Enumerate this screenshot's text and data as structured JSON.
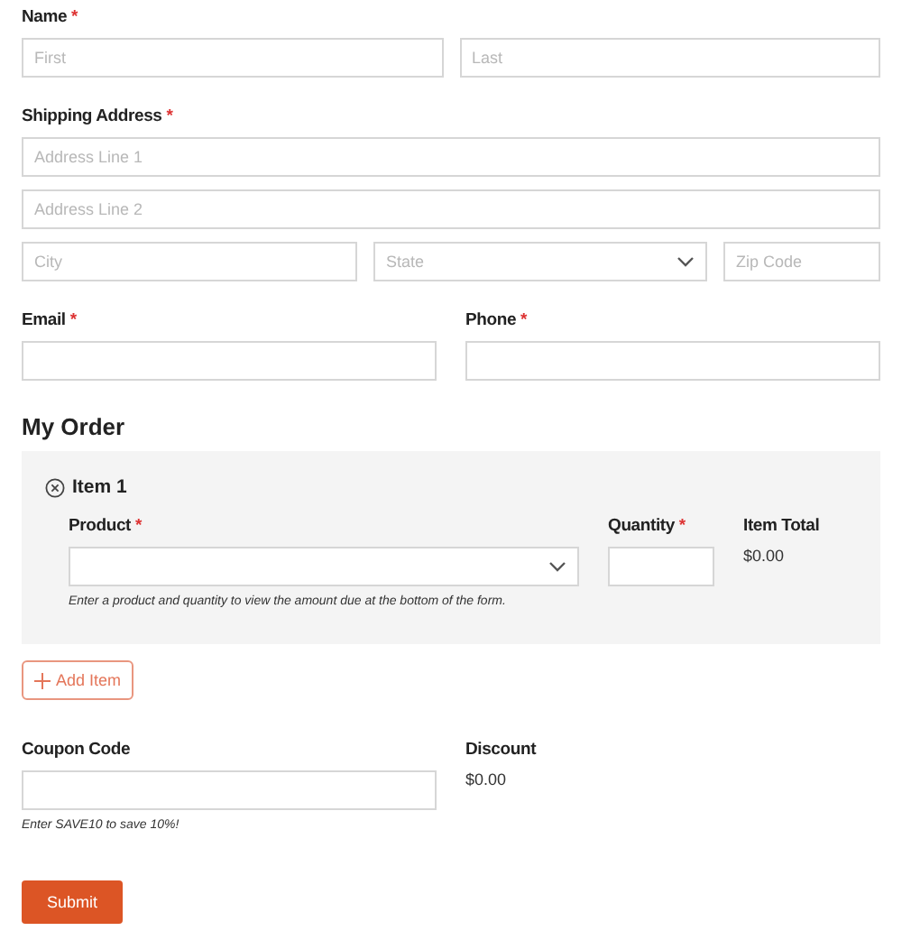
{
  "name": {
    "label": "Name",
    "required_mark": "*",
    "inputs": [
      {
        "kind": "text",
        "placeholder": "First"
      },
      {
        "kind": "text",
        "placeholder": "Last"
      }
    ]
  },
  "shipping_address": {
    "label": "Shipping Address",
    "required_mark": "*",
    "rows": [
      [
        {
          "kind": "text",
          "placeholder": "Address Line 1"
        }
      ],
      [
        {
          "kind": "text",
          "placeholder": "Address Line 2"
        }
      ],
      [
        {
          "kind": "text",
          "placeholder": "City"
        },
        {
          "kind": "select",
          "placeholder": "State"
        },
        {
          "kind": "text",
          "placeholder": "Zip Code"
        }
      ]
    ]
  },
  "contact": [
    {
      "label": "Email",
      "required_mark": "*"
    },
    {
      "label": "Phone",
      "required_mark": "*"
    }
  ],
  "order": {
    "title": "My Order",
    "items": [
      {
        "title": "Item 1",
        "product": {
          "label": "Product",
          "required_mark": "*"
        },
        "quantity": {
          "label": "Quantity",
          "required_mark": "*"
        },
        "item_total": {
          "label": "Item Total",
          "value": "$0.00"
        },
        "hint": "Enter a product and quantity to view the amount due at the bottom of the form."
      }
    ],
    "add_button": "Add Item"
  },
  "coupon": {
    "label": "Coupon Code",
    "hint": "Enter SAVE10 to save 10%!"
  },
  "discount": {
    "label": "Discount",
    "value": "$0.00"
  },
  "submit": "Submit"
}
